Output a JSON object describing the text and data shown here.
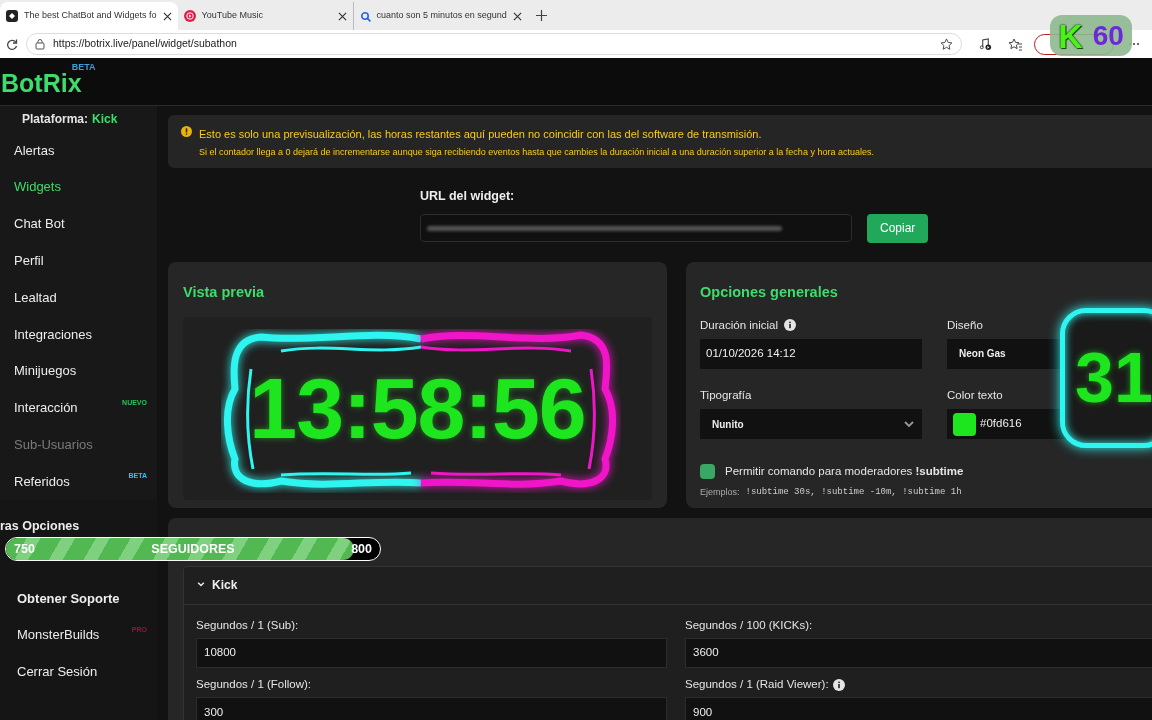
{
  "browser": {
    "tabs": [
      {
        "title": "The best ChatBot and Widgets fo",
        "selected": true
      },
      {
        "title": "YouTube Music",
        "selected": false
      },
      {
        "title": "cuanto son 5 minutos en segund",
        "selected": false
      }
    ],
    "address": "https://botrix.live/panel/widget/subathon"
  },
  "header": {
    "logo": "BotRix",
    "logo_badge": "BETA"
  },
  "sidebar": {
    "platform_label": "Plataforma:",
    "platform": "Kick",
    "items": [
      {
        "label": "Alertas",
        "selected": false,
        "disabled": false
      },
      {
        "label": "Widgets",
        "selected": true,
        "disabled": false
      },
      {
        "label": "Chat Bot",
        "selected": false,
        "disabled": false
      },
      {
        "label": "Perfil",
        "selected": false,
        "disabled": false
      },
      {
        "label": "Lealtad",
        "selected": false,
        "disabled": false
      },
      {
        "label": "Integraciones",
        "selected": false,
        "disabled": false
      },
      {
        "label": "Minijuegos",
        "selected": false,
        "disabled": false
      },
      {
        "label": "Interacción",
        "selected": false,
        "disabled": false,
        "badge": "NUEVO",
        "color": "#22c55e"
      },
      {
        "label": "Sub-Usuarios",
        "selected": false,
        "disabled": true
      },
      {
        "label": "Referidos",
        "selected": false,
        "disabled": false,
        "badge": "BETA",
        "color": "#38bdf8"
      }
    ],
    "section": "ras Opciones",
    "more_items": [
      {
        "label": "Obtener Soporte",
        "bold": true
      },
      {
        "label": "MonsterBuilds",
        "bold": false,
        "badge": "PRO",
        "color": "#9f1239"
      },
      {
        "label": "Cerrar Sesión",
        "bold": false
      }
    ]
  },
  "notice": {
    "title": "Esto es solo una previsualización, las horas restantes aquí pueden no coincidir con las del software de transmisión.",
    "detail": "Si el contador llega a 0 dejará de incrementarse aunque siga recibiendo eventos hasta que cambies la duración inicial a una duración superior a la fecha y hora actuales."
  },
  "widget_url": {
    "label": "URL del widget:",
    "button": "Copiar"
  },
  "preview": {
    "title": "Vista previa",
    "timer": "13:58:56"
  },
  "options": {
    "title": "Opciones generales",
    "fields": [
      {
        "label": "Duración inicial",
        "info": true,
        "kind": "input",
        "value": "01/10/2026 14:12"
      },
      {
        "label": "Diseño",
        "kind": "plain",
        "value": "Neon Gas"
      },
      {
        "label": "Tipografía",
        "kind": "select",
        "value": "Nunito"
      },
      {
        "label": "Color texto",
        "kind": "color",
        "value": "#0fd616",
        "color": "#1ee61e"
      }
    ],
    "checkbox": {
      "label": "Permitir comando para moderadores **!subtime**",
      "checked": true
    },
    "examples_label": "Ejemplos:",
    "examples": "!subtime 30s, !subtime -10m, !subtime 1h"
  },
  "events": {
    "group": "Kick",
    "expanded": true,
    "fields": [
      {
        "label": "Segundos / 1 (Sub):",
        "info": false,
        "value": "10800"
      },
      {
        "label": "Segundos / 100 (KICKs):",
        "info": false,
        "value": "3600"
      },
      {
        "label": "Segundos / 1 (Follow):",
        "info": false,
        "value": "300"
      },
      {
        "label": "Segundos / 1 (Raid Viewer):",
        "info": true,
        "value": "900"
      }
    ]
  },
  "overlays": {
    "badge": {
      "letter": "K",
      "count": "60"
    },
    "followers": {
      "start": "750",
      "label": "SEGUIDORES",
      "goal": "800",
      "level": 0.93
    },
    "timer_peek": "31"
  }
}
